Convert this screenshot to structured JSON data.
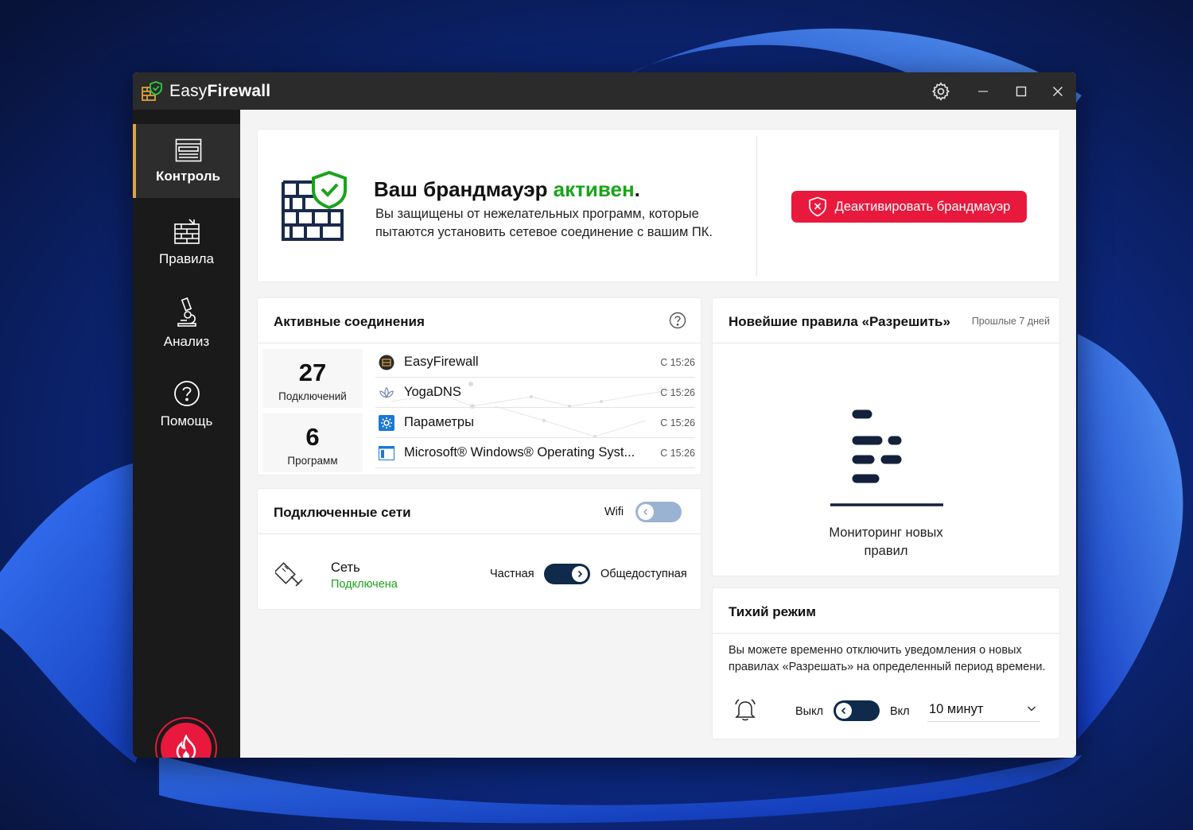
{
  "app": {
    "title_prefix": "Easy",
    "title_bold": "Firewall"
  },
  "sidebar": {
    "items": [
      {
        "label": "Контроль",
        "icon": "dashboard-icon",
        "active": true
      },
      {
        "label": "Правила",
        "icon": "rules-wall-icon",
        "active": false
      },
      {
        "label": "Анализ",
        "icon": "microscope-icon",
        "active": false
      },
      {
        "label": "Помощь",
        "icon": "help-circle-icon",
        "active": false
      }
    ],
    "fire_button_icon": "flame-icon"
  },
  "status": {
    "title_prefix": "Ваш брандмауэр ",
    "title_state": "активен",
    "title_suffix": ".",
    "description": "Вы защищены от нежелательных программ, которые пытаются установить сетевое соединение с вашим ПК.",
    "deactivate_label": "Деактивировать брандмауэр"
  },
  "connections": {
    "title": "Активные соединения",
    "stats": [
      {
        "value": "27",
        "label": "Подключений"
      },
      {
        "value": "6",
        "label": "Программ"
      }
    ],
    "rows": [
      {
        "name": "EasyFirewall",
        "time": "С 15:26",
        "icon": "easyfirewall-icon"
      },
      {
        "name": "YogaDNS",
        "time": "С 15:26",
        "icon": "yogadns-lotus-icon"
      },
      {
        "name": "Параметры",
        "time": "С 15:26",
        "icon": "settings-gear-icon"
      },
      {
        "name": "Microsoft® Windows® Operating Syst...",
        "time": "С 15:26",
        "icon": "windows-window-icon"
      }
    ]
  },
  "networks": {
    "title": "Подключенные сети",
    "wifi_label": "Wifi",
    "network_name": "Сеть",
    "network_status": "Подключена",
    "private_label": "Частная",
    "public_label": "Общедоступная"
  },
  "newest_rules": {
    "title": "Новейшие правила «Разрешить»",
    "period": "Прошлые 7 дней",
    "empty_text_line1": "Мониторинг новых",
    "empty_text_line2": "правил"
  },
  "quiet_mode": {
    "title": "Тихий режим",
    "description": "Вы можете временно отключить уведомления о новых правилах «Разрешать» на определенный период времени.",
    "off_label": "Выкл",
    "on_label": "Вкл",
    "duration": "10 минут"
  },
  "colors": {
    "accent_red": "#e8193c",
    "active_green": "#1aa31a",
    "toggle_dark": "#0f2a4a",
    "toggle_light": "#9bb3d3",
    "nav_active_border": "#e2a23a"
  }
}
